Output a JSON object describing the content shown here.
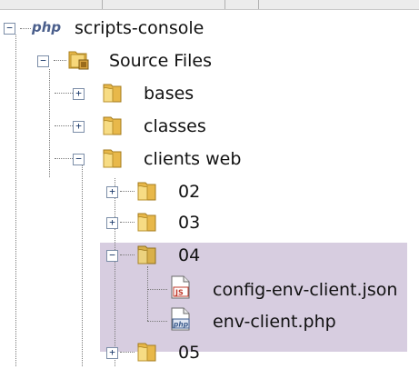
{
  "tree": {
    "project": {
      "label": "scripts-console",
      "icon": "php-project-icon"
    },
    "source_files": {
      "label": "Source Files",
      "icon": "source-folder-icon"
    },
    "folders": {
      "bases": "bases",
      "classes": "classes",
      "clients_web": "clients web"
    },
    "clients_web_children": {
      "f02": "02",
      "f03": "03",
      "f04": "04",
      "f05": "05"
    },
    "folder_04_children": {
      "config": {
        "label": "config-env-client.json",
        "icon": "json-file-icon",
        "badge": "JS"
      },
      "env": {
        "label": "env-client.php",
        "icon": "php-file-icon",
        "badge": "php"
      }
    },
    "toggles": {
      "expanded": "−",
      "collapsed": "+"
    },
    "colors": {
      "selection": "#d7cde0",
      "folder": "#f2c94c",
      "json_badge": "#c0392b",
      "php_badge": "#3b5b8c"
    }
  }
}
